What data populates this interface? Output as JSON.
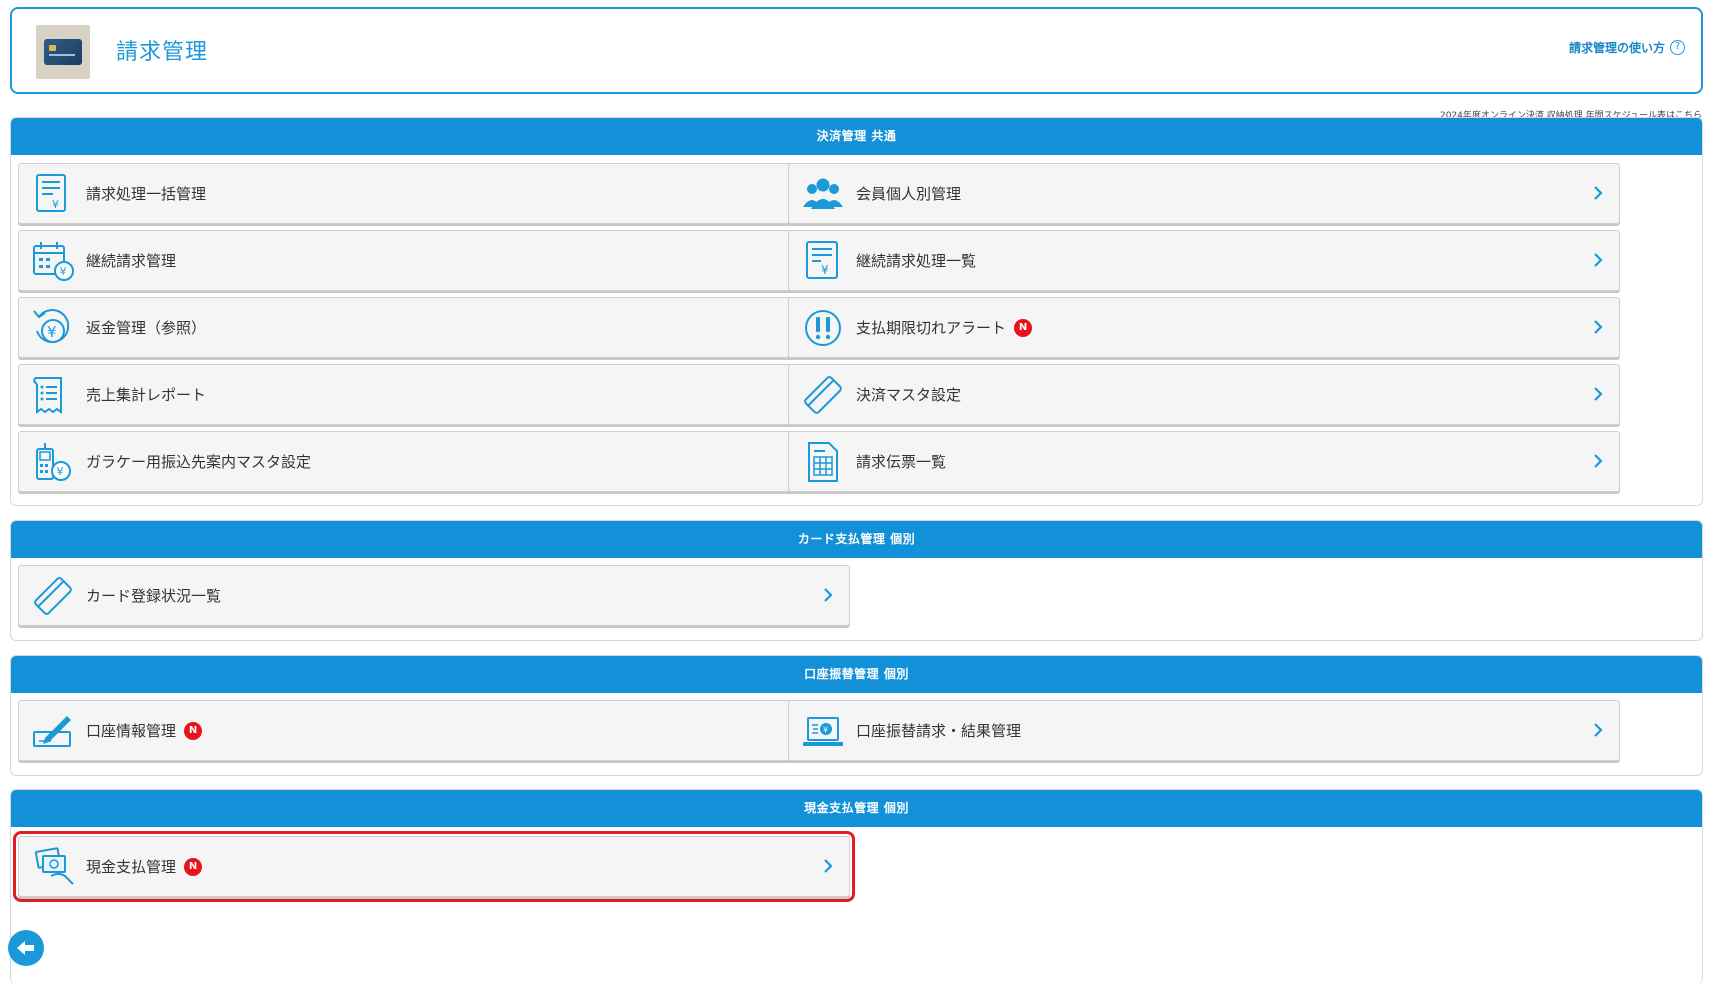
{
  "header": {
    "title": "請求管理",
    "help_link": "請求管理の使い方",
    "help_icon": "?"
  },
  "schedule_link": "2024年度オンライン決済 収納処理 年間スケジュール表はこちら",
  "sections": [
    {
      "title": "決済管理 共通",
      "items": [
        {
          "label": "請求処理一括管理",
          "icon": "invoice-yen-icon",
          "new": false
        },
        {
          "label": "会員個人別管理",
          "icon": "members-icon",
          "new": false
        },
        {
          "label": "継続請求管理",
          "icon": "calendar-yen-icon",
          "new": false
        },
        {
          "label": "継続請求処理一覧",
          "icon": "document-yen-icon",
          "new": false
        },
        {
          "label": "返金管理（参照）",
          "icon": "refund-yen-icon",
          "new": false
        },
        {
          "label": "支払期限切れアラート",
          "icon": "alert-icon",
          "new": true
        },
        {
          "label": "売上集計レポート",
          "icon": "report-icon",
          "new": false
        },
        {
          "label": "決済マスタ設定",
          "icon": "card-icon",
          "new": false
        },
        {
          "label": "ガラケー用振込先案内マスタ設定",
          "icon": "feature-phone-yen-icon",
          "new": false
        },
        {
          "label": "請求伝票一覧",
          "icon": "slip-icon",
          "new": false
        }
      ]
    },
    {
      "title": "カード支払管理 個別",
      "items": [
        {
          "label": "カード登録状況一覧",
          "icon": "card-icon",
          "new": false
        }
      ]
    },
    {
      "title": "口座振替管理 個別",
      "items": [
        {
          "label": "口座情報管理",
          "icon": "check-pen-icon",
          "new": true
        },
        {
          "label": "口座振替請求・結果管理",
          "icon": "laptop-yen-icon",
          "new": false
        }
      ]
    },
    {
      "title": "現金支払管理 個別",
      "items": [
        {
          "label": "現金支払管理",
          "icon": "cash-hand-icon",
          "new": true
        }
      ]
    }
  ],
  "badge_text": "N",
  "colors": {
    "accent": "#1291d9",
    "badge": "#e8121c",
    "highlight": "#e01e26"
  }
}
